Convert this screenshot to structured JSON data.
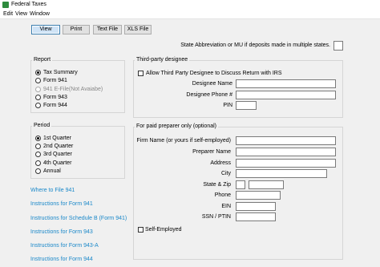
{
  "window": {
    "title": "Federal Taxes"
  },
  "menu": [
    "Edit",
    "View",
    "Window"
  ],
  "toolbar": {
    "view": "View",
    "print": "Print",
    "textfile": "Text File",
    "xlsfile": "XLS File"
  },
  "state_abbrev": {
    "label": "State Abbreviation or MU if deposits made in multiple states.",
    "value": ""
  },
  "report": {
    "legend": "Report",
    "options": [
      "Tax Summary",
      "Form 941",
      "941 E-File(Not Avaiabe)",
      "Form 943",
      "Form 944"
    ],
    "selected": "Tax Summary"
  },
  "period": {
    "legend": "Period",
    "options": [
      "1st Quarter",
      "2nd Quarter",
      "3rd Quarter",
      "4th Quarter",
      "Annual"
    ],
    "selected": "1st Quarter"
  },
  "links": [
    "Where to File 941",
    "Instructions for Form 941",
    "Instructions for Schedule B (Form 941)",
    "Instructions for Form 943",
    "Instructions for Form 943-A",
    "Instructions for Form 944"
  ],
  "third_party": {
    "legend": "Third-party designee",
    "allow_label": "Allow Third Party Designee to Discuss Return with IRS",
    "designee_name_label": "Designee Name",
    "designee_phone_label": "Designee Phone #",
    "pin_label": "PIN"
  },
  "preparer": {
    "legend": "For paid preparer only (optional)",
    "firm_label": "Firm Name (or yours if self-employed)",
    "preparer_name_label": "Preparer Name",
    "address_label": "Address",
    "city_label": "City",
    "state_zip_label": "State & Zip",
    "phone_label": "Phone",
    "ein_label": "EIN",
    "ssn_label": "SSN / PTIN",
    "self_employed_label": "Self-Employed"
  },
  "colors": {
    "link": "#1a88c9",
    "window_bg": "#f0f0f0"
  }
}
